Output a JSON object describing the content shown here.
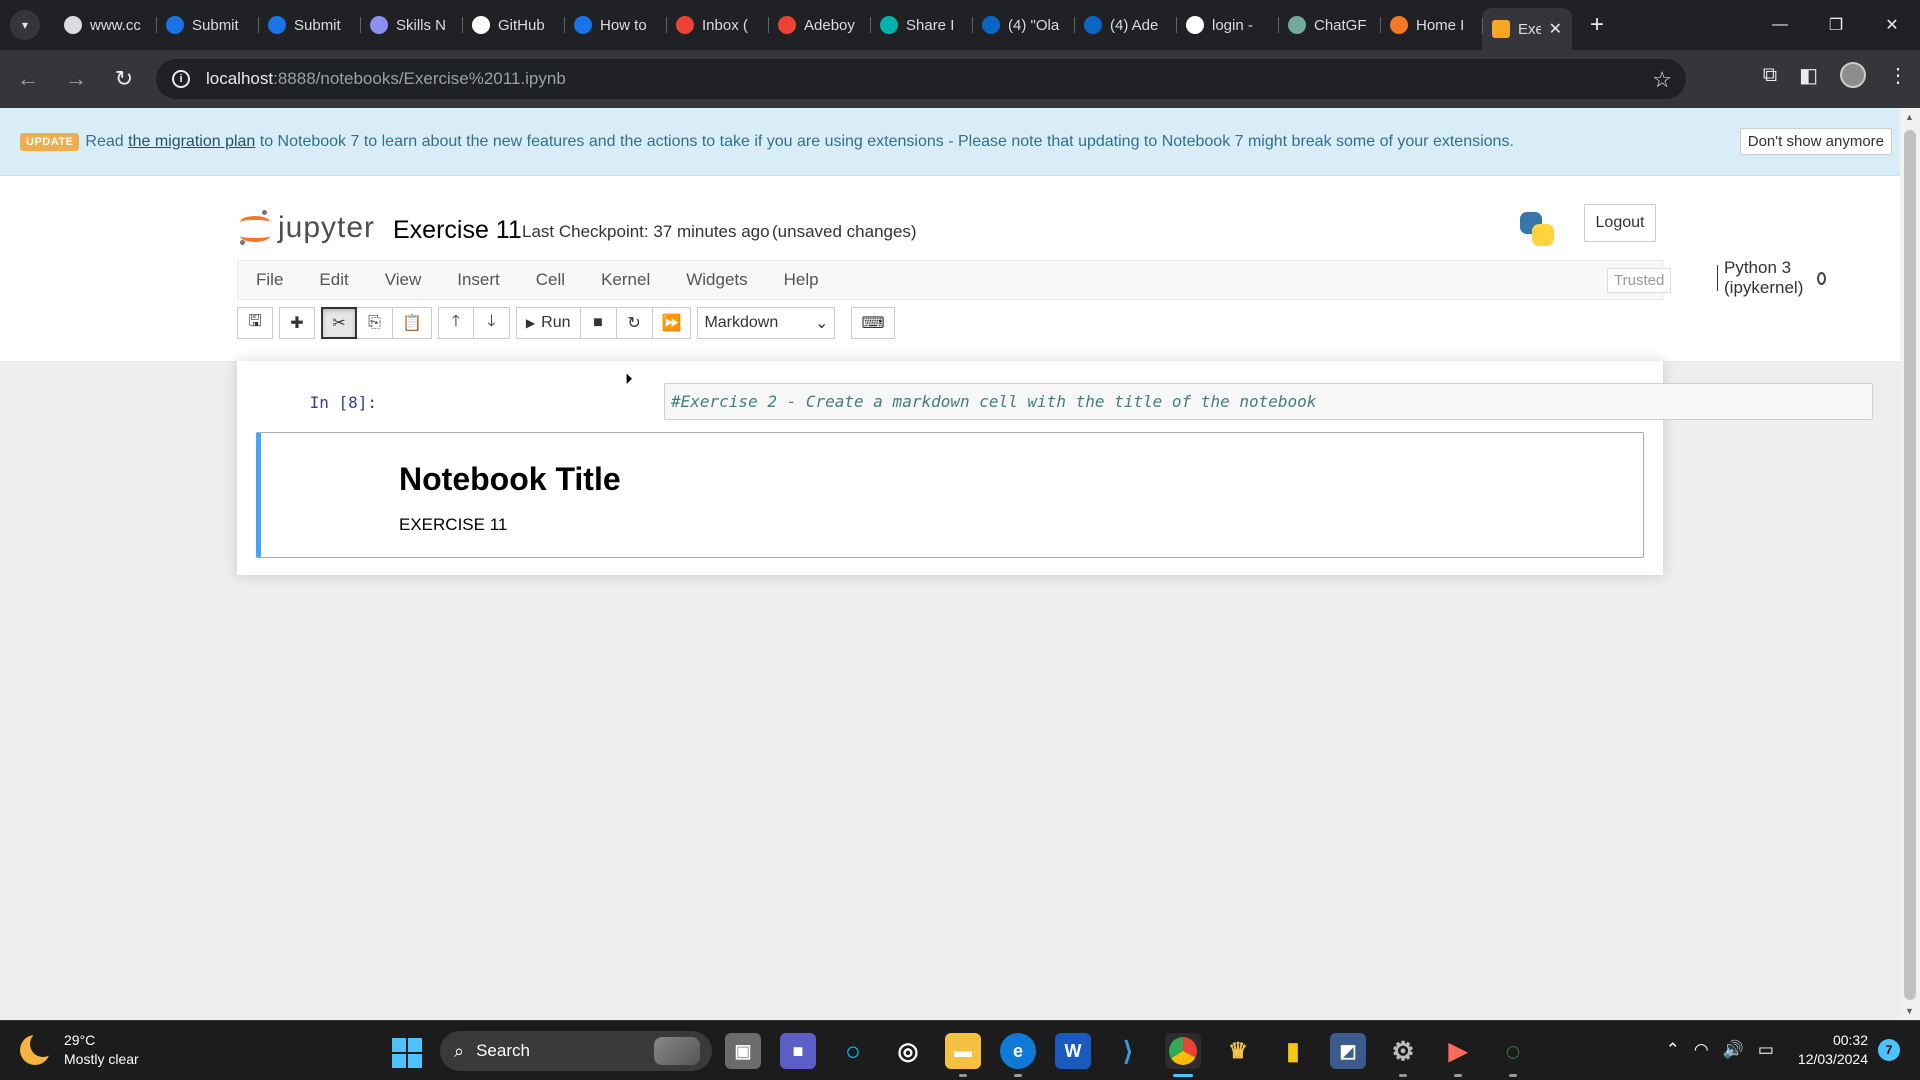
{
  "browser": {
    "tabs": [
      {
        "title": "www.cc",
        "icon": "coursera-icon",
        "color": "#dadce0"
      },
      {
        "title": "Submit",
        "icon": "coursera-icon",
        "color": "#1a73e8"
      },
      {
        "title": "Submit",
        "icon": "coursera-icon",
        "color": "#1a73e8"
      },
      {
        "title": "Skills N",
        "icon": "skills-network-icon",
        "color": "#8e8ef0"
      },
      {
        "title": "GitHub",
        "icon": "github-icon",
        "color": "#ffffff"
      },
      {
        "title": "How to",
        "icon": "coursera-icon",
        "color": "#1a73e8"
      },
      {
        "title": "Inbox (",
        "icon": "gmail-icon",
        "color": "#ea4335"
      },
      {
        "title": "Adeboy",
        "icon": "gmail-icon",
        "color": "#ea4335"
      },
      {
        "title": "Share I",
        "icon": "chegg-icon",
        "color": "#00b2a9"
      },
      {
        "title": "(4) \"Ola",
        "icon": "linkedin-icon",
        "color": "#0a66c2"
      },
      {
        "title": "(4) Ade",
        "icon": "linkedin-icon",
        "color": "#0a66c2"
      },
      {
        "title": "login -",
        "icon": "github-icon",
        "color": "#ffffff"
      },
      {
        "title": "ChatGF",
        "icon": "chatgpt-icon",
        "color": "#74aa9c"
      },
      {
        "title": "Home I",
        "icon": "jupyter-icon",
        "color": "#f37726"
      }
    ],
    "active_tab": {
      "title": "Exe",
      "icon": "jupyter-notebook-icon",
      "color": "#f5a623"
    },
    "new_tab": "+",
    "url_host": "localhost",
    "url_path": ":8888/notebooks/Exercise%2011.ipynb"
  },
  "banner": {
    "badge": "UPDATE",
    "prefix": "Read",
    "link": "the migration plan",
    "message": "to Notebook 7 to learn about the new features and the actions to take if you are using extensions - Please note that updating to Notebook 7 might break some of your extensions.",
    "dismiss": "Don't show anymore"
  },
  "header": {
    "logo_text": "jupyter",
    "notebook_name": "Exercise 11",
    "checkpoint": "Last Checkpoint: 37 minutes ago",
    "unsaved": "(unsaved changes)",
    "logout": "Logout"
  },
  "menu": {
    "items": [
      "File",
      "Edit",
      "View",
      "Insert",
      "Cell",
      "Kernel",
      "Widgets",
      "Help"
    ],
    "trusted": "Trusted",
    "kernel": "Python 3 (ipykernel)"
  },
  "toolbar": {
    "run_label": "Run",
    "cell_type": "Markdown"
  },
  "cells": {
    "code_prompt": "In [8]:",
    "code_source": "#Exercise 2 - Create a markdown cell with the title of the notebook",
    "md_title": "Notebook Title",
    "md_body": "EXERCISE 11"
  },
  "taskbar": {
    "temperature": "29°C",
    "weather": "Mostly clear",
    "search": "Search",
    "time": "00:32",
    "date": "12/03/2024",
    "notifications": "7",
    "accent": "#4cc2ff"
  }
}
